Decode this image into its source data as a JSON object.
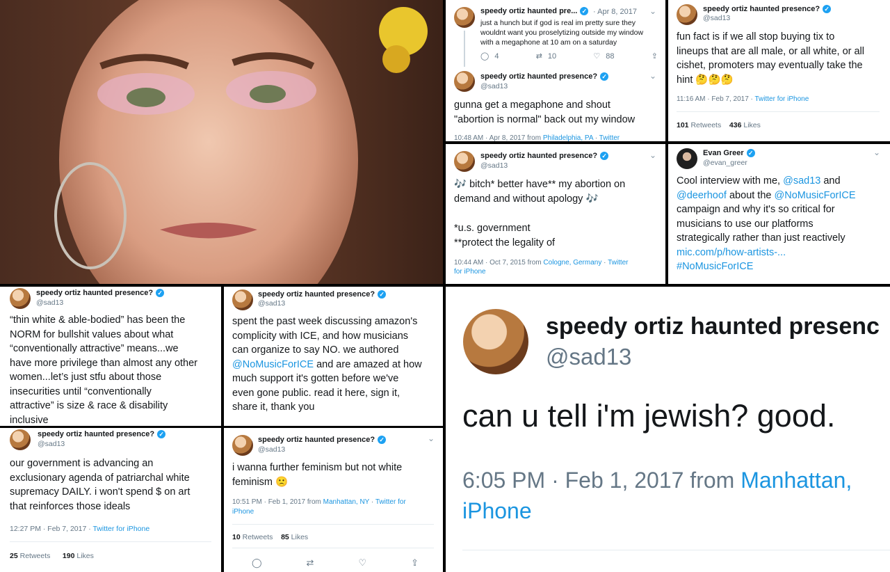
{
  "colors": {
    "link": "#1b95e0",
    "verified": "#1da1f2",
    "muted": "#657786"
  },
  "author": {
    "name": "speedy ortiz haunted presence?",
    "name_truncated": "speedy ortiz haunted pre...",
    "name_big": "speedy ortiz haunted presenc",
    "handle": "@sad13"
  },
  "t1": {
    "date": "Apr 8, 2017",
    "text": "just a hunch but if god is real im pretty sure they\nwouldnt want you proselytizing outside my window\nwith a megaphone at 10 am on a saturday",
    "replies": "4",
    "retweets": "10",
    "likes": "88"
  },
  "t2": {
    "text": "gunna get a megaphone and shout\n\"abortion is normal\" back out my window",
    "meta_time": "10:48 AM · Apr 8, 2017 from ",
    "meta_place": "Philadelphia, PA",
    "meta_sep": " · ",
    "meta_client": "Twitter"
  },
  "t3": {
    "text_pre": "fun fact is if we all stop buying tix to\nlineups that are all male, or all white, or all\ncishet, promoters may eventually take the\nhint ",
    "emoji": "🤔🤔🤔",
    "meta_time": "11:16 AM · Feb 7, 2017 · ",
    "meta_client": "Twitter for iPhone",
    "retweets_n": "101",
    "retweets_l": "Retweets",
    "likes_n": "436",
    "likes_l": "Likes"
  },
  "t4": {
    "note": "🎶",
    "line1": " bitch* better have** my abortion on\ndemand and without apology ",
    "line2": "\n*u.s. government\n**protect the legality of",
    "meta_time": "10:44 AM · Oct 7, 2015 from ",
    "meta_place": "Cologne, Germany",
    "meta_sep": " · ",
    "meta_client": "Twitter\nfor iPhone"
  },
  "t5": {
    "name": "Evan Greer",
    "handle": "@evan_greer",
    "p1": "Cool interview with me, ",
    "m1": "@sad13",
    "p2": " and\n",
    "m2": "@deerhoof",
    "p3": " about the ",
    "m3": "@NoMusicForICE",
    "p4": "\ncampaign and why it's so critical for\nmusicians to use our platforms\nstrategically rather than just reactively\n",
    "url": "mic.com/p/how-artists-...",
    "tag": "\n#NoMusicForICE"
  },
  "t6": {
    "text": "“thin white & able-bodied” has been the\nNORM for bullshit values about what\n“conventionally attractive” means...we\nhave more privilege than almost any other\nwomen...let’s just stfu about those\ninsecurities until “conventionally\nattractive” is size & race & disability\ninclusive"
  },
  "t7": {
    "p1": "spent the past week discussing amazon's\ncomplicity with ICE, and how musicians\ncan organize to say NO. we authored\n",
    "mention": "@NoMusicForICE",
    "p2": " and are amazed at how\nmuch support it's gotten before we've\neven gone public. read it here, sign it,\nshare it, thank you"
  },
  "t8": {
    "text": "our government is advancing an\nexclusionary agenda of patriarchal white\nsupremacy DAILY. i won't spend $ on art\nthat reinforces those ideals",
    "meta_time": "12:27 PM · Feb 7, 2017 · ",
    "meta_client": "Twitter for iPhone",
    "retweets_n": "25",
    "retweets_l": "Retweets",
    "likes_n": "190",
    "likes_l": "Likes"
  },
  "t9": {
    "text": "i wanna further feminism but not white\nfeminism ",
    "emoji": "🙁",
    "meta_time": "10:51 PM · Feb 1, 2017 from ",
    "meta_place": "Manhattan, NY",
    "meta_sep": " · ",
    "meta_client": "Twitter for\niPhone",
    "retweets_n": "10",
    "retweets_l": "Retweets",
    "likes_n": "85",
    "likes_l": "Likes"
  },
  "t10": {
    "text": "can u tell i'm jewish? good.",
    "meta_time": "6:05 PM · Feb 1, 2017 from ",
    "meta_place": "Manhattan,\niPhone"
  }
}
